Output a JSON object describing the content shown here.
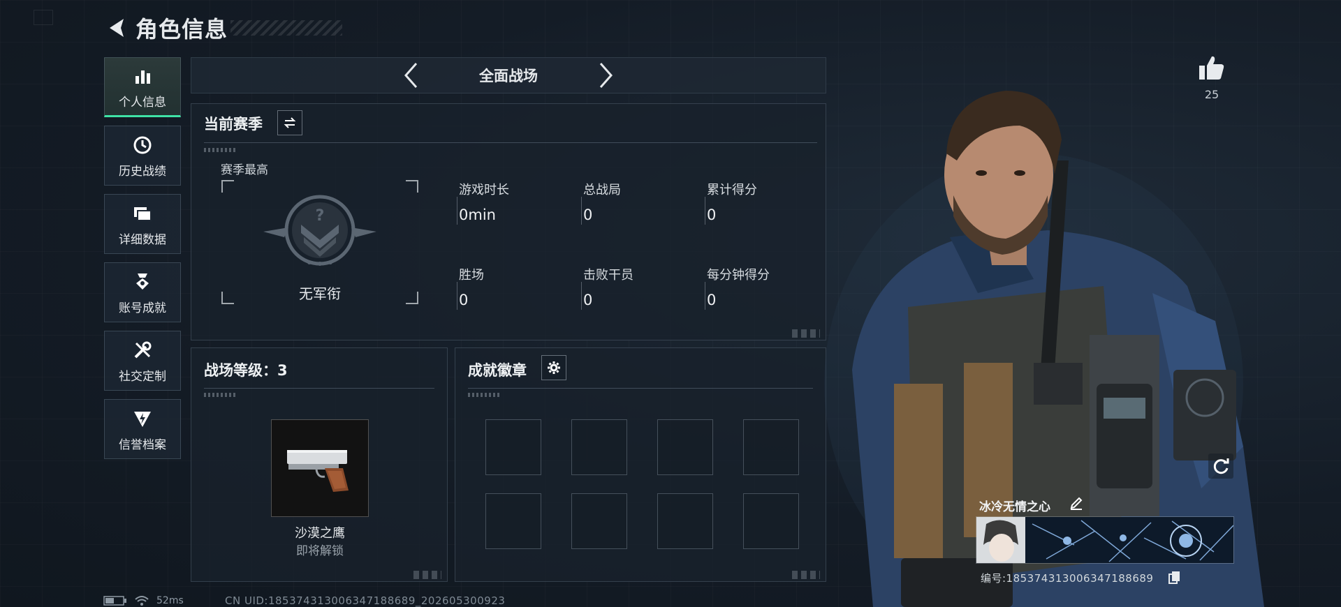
{
  "header": {
    "title": "角色信息"
  },
  "sidebar": {
    "items": [
      {
        "label": "个人信息",
        "icon": "bar-chart-icon",
        "active": true
      },
      {
        "label": "历史战绩",
        "icon": "history-clock-icon",
        "active": false
      },
      {
        "label": "详细数据",
        "icon": "folder-stack-icon",
        "active": false
      },
      {
        "label": "账号成就",
        "icon": "achievement-medal-icon",
        "active": false
      },
      {
        "label": "社交定制",
        "icon": "wrench-screwdriver-icon",
        "active": false
      },
      {
        "label": "信誉档案",
        "icon": "shield-bolt-icon",
        "active": false
      }
    ]
  },
  "mode": {
    "label": "全面战场"
  },
  "season": {
    "title": "当前赛季",
    "best_label": "赛季最高",
    "rank_name": "无军衔",
    "stats": [
      {
        "label": "游戏时长",
        "value": "0min"
      },
      {
        "label": "总战局",
        "value": "0"
      },
      {
        "label": "累计得分",
        "value": "0"
      },
      {
        "label": "胜场",
        "value": "0"
      },
      {
        "label": "击败干员",
        "value": "0"
      },
      {
        "label": "每分钟得分",
        "value": "0"
      }
    ]
  },
  "battlefield": {
    "title": "战场等级：3",
    "weapon_name": "沙漠之鹰",
    "weapon_status": "即将解锁"
  },
  "badges": {
    "title": "成就徽章",
    "slot_count": 8
  },
  "profile": {
    "likes": "25",
    "player_name": "冰冷无情之心",
    "player_id": "编号:18537431300634718868​9"
  },
  "status": {
    "ping": "52ms",
    "uid": "CN UID:18537431300634718868​9_202605300923"
  },
  "colors": {
    "accent_green": "#3fe3a6",
    "background": "#121a24",
    "panel": "#18212c"
  }
}
